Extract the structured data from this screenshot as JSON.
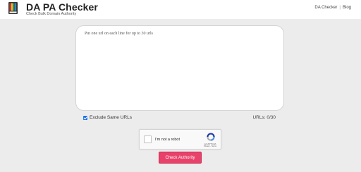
{
  "header": {
    "title": "DA PA Checker",
    "subtitle": "Check Bulk Domain Authority",
    "logo_icon": "book-stack-logo",
    "nav": [
      {
        "label": "DA Checker"
      },
      {
        "label": "Blog"
      }
    ],
    "nav_separator": "|"
  },
  "form": {
    "url_placeholder": "Put one url on each line for up to 30 urls",
    "url_value": "",
    "exclude_label": "Exclude Same URLs",
    "exclude_checked": true,
    "url_count": "URLs: 0/30",
    "captcha": {
      "label": "I'm not a robot",
      "brand": "reCAPTCHA",
      "links": "Privacy - Terms"
    },
    "submit_label": "Check Authority"
  },
  "colors": {
    "accent_button": "#e8416a",
    "checkbox": "#1a73e8",
    "background": "#ececec"
  }
}
